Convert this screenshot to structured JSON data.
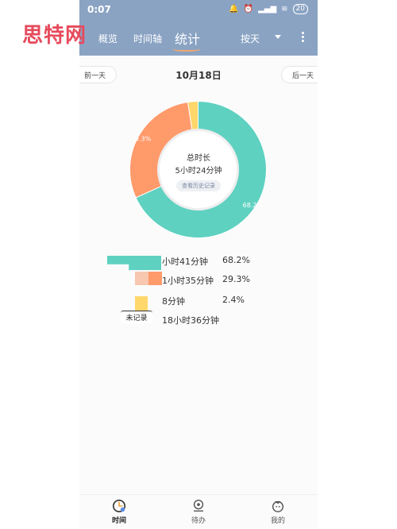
{
  "watermark": "思特网",
  "status_bar": {
    "time": "0:07",
    "battery": "20"
  },
  "top_nav": {
    "tabs": [
      {
        "label": "概览",
        "active": false
      },
      {
        "label": "时间轴",
        "active": false
      },
      {
        "label": "统计",
        "active": true
      }
    ],
    "range_label": "按天",
    "icons": {
      "dropdown": "chevron-down-icon",
      "more": "more-vertical-icon"
    }
  },
  "date_nav": {
    "prev_label": "前一天",
    "date": "10月18日",
    "next_label": "后一天"
  },
  "chart_data": {
    "type": "pie",
    "style": "donut",
    "slices": [
      {
        "label": "小时41分钟",
        "value": 68.2,
        "display": "68.2%",
        "color": "#5fd1c1"
      },
      {
        "label": "1小时35分钟",
        "value": 29.3,
        "display": "29.3%",
        "color": "#ff9a6b"
      },
      {
        "label": "8分钟",
        "value": 2.4,
        "display": "2.4%",
        "color": "#ffd76b"
      }
    ],
    "center_title": "总时长",
    "center_value": "5小时24分钟",
    "center_button": "查看历史记录"
  },
  "legend": [
    {
      "text": "小时41分钟",
      "pct": "68.2%",
      "color": "#5fd1c1"
    },
    {
      "text": "1小时35分钟",
      "pct": "29.3%",
      "color": "#ff9a6b"
    },
    {
      "text": "8分钟",
      "pct": "2.4%",
      "color": "#ffd76b"
    },
    {
      "text": "18小时36分钟",
      "pct": "",
      "tag": "未记录"
    }
  ],
  "bottom_nav": [
    {
      "label": "时间",
      "icon": "clock-icon",
      "active": true
    },
    {
      "label": "待办",
      "icon": "todo-icon",
      "active": false
    },
    {
      "label": "我的",
      "icon": "tomato-icon",
      "active": false
    }
  ]
}
